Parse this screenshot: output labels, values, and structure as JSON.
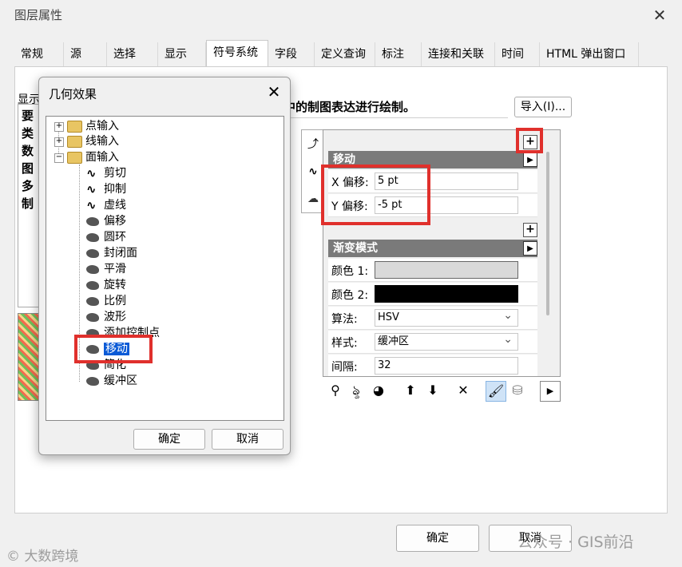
{
  "window": {
    "title": "图层属性",
    "close_glyph": "✕"
  },
  "tabs": [
    {
      "label": "常规"
    },
    {
      "label": "源"
    },
    {
      "label": "选择"
    },
    {
      "label": "显示"
    },
    {
      "label": "符号系统"
    },
    {
      "label": "字段"
    },
    {
      "label": "定义查询"
    },
    {
      "label": "标注"
    },
    {
      "label": "连接和关联"
    },
    {
      "label": "时间"
    },
    {
      "label": "HTML 弹出窗口"
    }
  ],
  "active_tab": "符号系统",
  "partial": {
    "show_label": "显示",
    "left_list": [
      "要",
      "类",
      "数",
      "图",
      "多",
      "制"
    ],
    "draw_text": "中的制图表达进行绘制。",
    "import_button": "导入(I)..."
  },
  "layers_panel": {
    "items": [
      {
        "icon": "marker-effect-icon",
        "glyph": "⤴"
      },
      {
        "icon": "stroke-icon",
        "glyph": "∿"
      },
      {
        "icon": "polygon-fill-icon",
        "glyph": "☁"
      }
    ]
  },
  "move_section": {
    "header": "移动",
    "x_label": "X 偏移:",
    "x_value": "5 pt",
    "y_label": "Y 偏移:",
    "y_value": "-5 pt",
    "arrow_glyph": "▶",
    "plus_glyph": "+"
  },
  "gradient_section": {
    "header": "渐变模式",
    "color1_label": "颜色 1:",
    "color1": "#d9d9d9",
    "color2_label": "颜色 2:",
    "color2": "#000000",
    "algorithm_label": "算法:",
    "algorithm_value": "HSV",
    "style_label": "样式:",
    "style_value": "缓冲区",
    "interval_label": "间隔:",
    "interval_value": "32"
  },
  "toolbar": {
    "tools": [
      {
        "name": "add-marker-tool-icon",
        "glyph": "⚲"
      },
      {
        "name": "add-stroke-tool-icon",
        "glyph": "ৡ"
      },
      {
        "name": "add-fill-tool-icon",
        "glyph": "◕"
      },
      {
        "name": "move-up-icon",
        "glyph": "⬆"
      },
      {
        "name": "move-down-icon",
        "glyph": "⬇"
      },
      {
        "name": "delete-icon",
        "glyph": "✕"
      },
      {
        "name": "brush-icon",
        "glyph": "🖌"
      },
      {
        "name": "database-icon",
        "glyph": "⛁"
      },
      {
        "name": "more-arrow-icon",
        "glyph": "▶"
      }
    ]
  },
  "bottom_buttons": {
    "ok": "确定",
    "cancel": "取消"
  },
  "watermarks": {
    "left": "© 大数跨境",
    "right": "公众号 · GIS前沿"
  },
  "dialog": {
    "title": "几何效果",
    "close_glyph": "✕",
    "folders": [
      {
        "label": "点输入",
        "expander": "+"
      },
      {
        "label": "线输入",
        "expander": "+"
      },
      {
        "label": "面输入",
        "expander": "−"
      }
    ],
    "line_effects": [
      {
        "label": "剪切"
      },
      {
        "label": "抑制"
      },
      {
        "label": "虚线"
      }
    ],
    "fill_effects": [
      {
        "label": "偏移"
      },
      {
        "label": "圆环"
      },
      {
        "label": "封闭面"
      },
      {
        "label": "平滑"
      },
      {
        "label": "旋转"
      },
      {
        "label": "比例"
      },
      {
        "label": "波形"
      },
      {
        "label": "添加控制点"
      },
      {
        "label": "移动"
      },
      {
        "label": "简化"
      },
      {
        "label": "缓冲区"
      }
    ],
    "selected": "移动",
    "ok": "确定",
    "cancel": "取消"
  }
}
